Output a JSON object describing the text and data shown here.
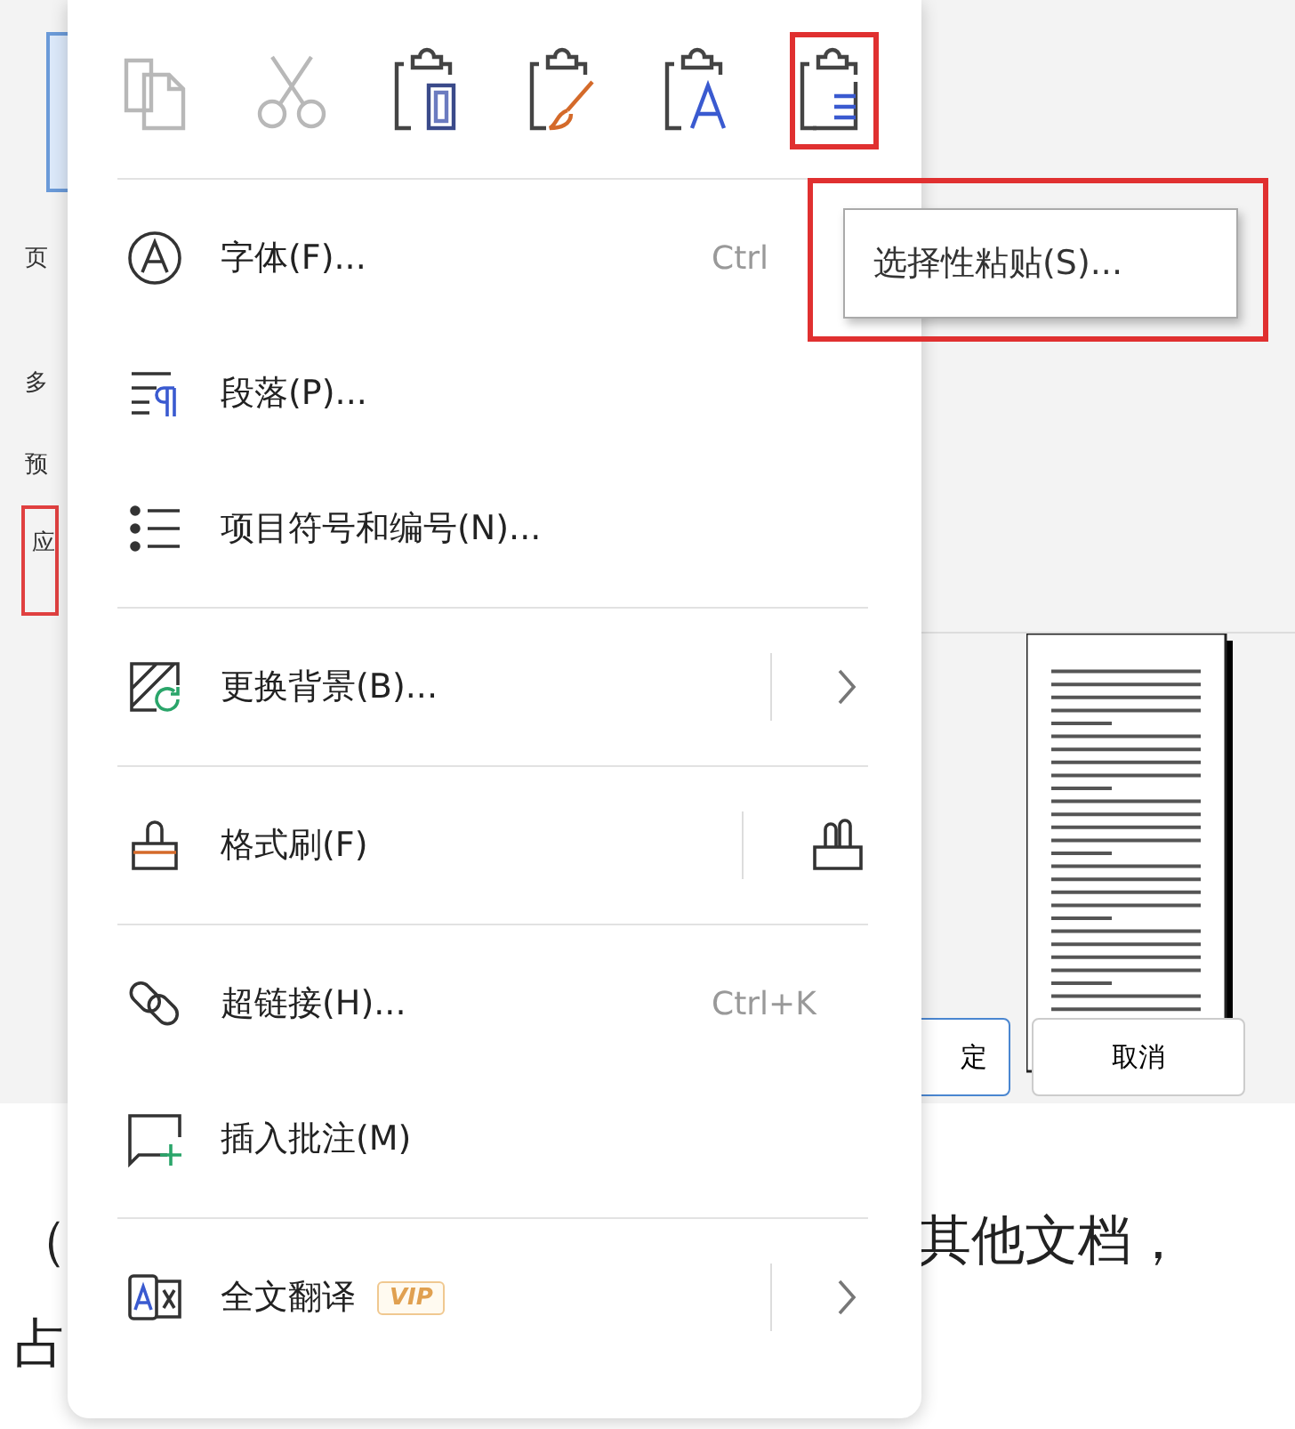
{
  "background_dialog": {
    "side_labels": [
      {
        "text": "页",
        "highlighted": false
      },
      {
        "text": "多",
        "highlighted": false
      },
      {
        "text": "预",
        "highlighted": false
      },
      {
        "text": "应",
        "highlighted": true
      }
    ],
    "buttons": [
      {
        "label": "定",
        "kind": "primary"
      },
      {
        "label": "取消",
        "kind": "normal"
      }
    ]
  },
  "document": {
    "lines": [
      {
        "left": "（",
        "right": "其他文档，"
      },
      {
        "left": "占"
      }
    ]
  },
  "context_menu": {
    "toolbar": [
      {
        "kind": "copy",
        "disabled": true,
        "highlighted": false
      },
      {
        "kind": "cut",
        "disabled": true,
        "highlighted": false
      },
      {
        "kind": "paste-keep",
        "disabled": false,
        "highlighted": false
      },
      {
        "kind": "paste-format",
        "disabled": false,
        "highlighted": false
      },
      {
        "kind": "paste-text",
        "disabled": false,
        "highlighted": false
      },
      {
        "kind": "paste-special",
        "disabled": false,
        "highlighted": true
      }
    ],
    "sections": [
      [
        {
          "kind": "font",
          "label": "字体(F)...",
          "shortcut": "Ctrl",
          "has_submenu": false,
          "has_side_button": false
        },
        {
          "kind": "paragraph",
          "label": "段落(P)...",
          "has_submenu": false,
          "has_side_button": false
        },
        {
          "kind": "bullets",
          "label": "项目符号和编号(N)...",
          "has_submenu": false,
          "has_side_button": false
        }
      ],
      [
        {
          "kind": "background",
          "label": "更换背景(B)...",
          "has_submenu": true,
          "has_side_button": false
        }
      ],
      [
        {
          "kind": "format-painter",
          "label": "格式刷(F)",
          "has_submenu": false,
          "has_side_button": true
        }
      ],
      [
        {
          "kind": "link",
          "label": "超链接(H)...",
          "shortcut": "Ctrl+K",
          "has_submenu": false,
          "has_side_button": false
        },
        {
          "kind": "comment",
          "label": "插入批注(M)",
          "has_submenu": false,
          "has_side_button": false
        }
      ],
      [
        {
          "kind": "translate",
          "label": "全文翻译",
          "badge": "VIP",
          "has_submenu": true,
          "has_side_button": false
        }
      ]
    ]
  },
  "tooltip": {
    "text": "选择性粘贴(S)...",
    "highlighted": true
  }
}
